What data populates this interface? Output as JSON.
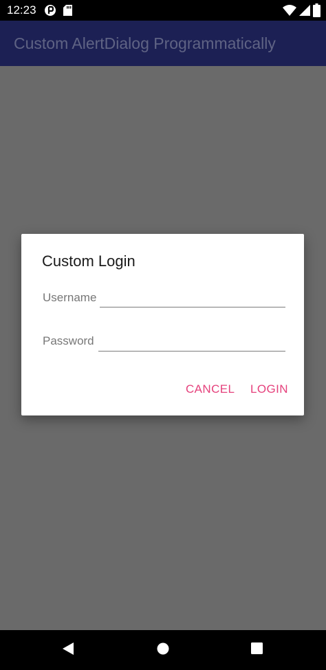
{
  "status_bar": {
    "time": "12:23"
  },
  "app_bar": {
    "title": "Custom AlertDialog Programmatically",
    "background_color": "#1c2054"
  },
  "dialog": {
    "title": "Custom Login",
    "username": {
      "label": "Username",
      "value": ""
    },
    "password": {
      "label": "Password",
      "value": ""
    },
    "cancel_label": "CANCEL",
    "login_label": "LOGIN",
    "accent_color": "#e5417c"
  },
  "nav_bar": {
    "icons": [
      "back-icon",
      "home-icon",
      "recents-icon"
    ]
  }
}
